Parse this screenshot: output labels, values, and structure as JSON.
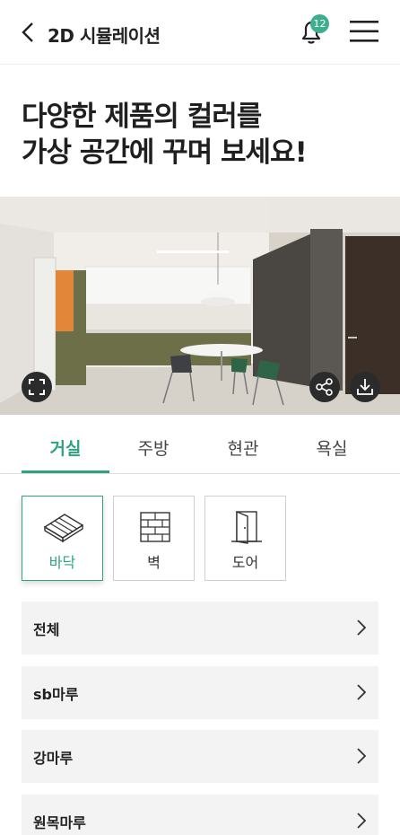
{
  "header": {
    "title": "2D 시뮬레이션",
    "notification_count": "12"
  },
  "headline": {
    "line1": "다양한 제품의 컬러를",
    "line2": "가상 공간에 꾸며 보세요!"
  },
  "tabs": [
    {
      "label": "거실",
      "active": true
    },
    {
      "label": "주방",
      "active": false
    },
    {
      "label": "현관",
      "active": false
    },
    {
      "label": "욕실",
      "active": false
    }
  ],
  "categories": [
    {
      "label": "바닥",
      "icon": "floor-icon",
      "active": true
    },
    {
      "label": "벽",
      "icon": "wall-icon",
      "active": false
    },
    {
      "label": "도어",
      "icon": "door-icon",
      "active": false
    }
  ],
  "product_list": [
    {
      "label": "전체"
    },
    {
      "label": "sb마루"
    },
    {
      "label": "강마루"
    },
    {
      "label": "원목마루"
    }
  ],
  "colors": {
    "accent": "#2fa37f",
    "badge": "#3fae8f",
    "list_bg": "#f3f3f3"
  }
}
